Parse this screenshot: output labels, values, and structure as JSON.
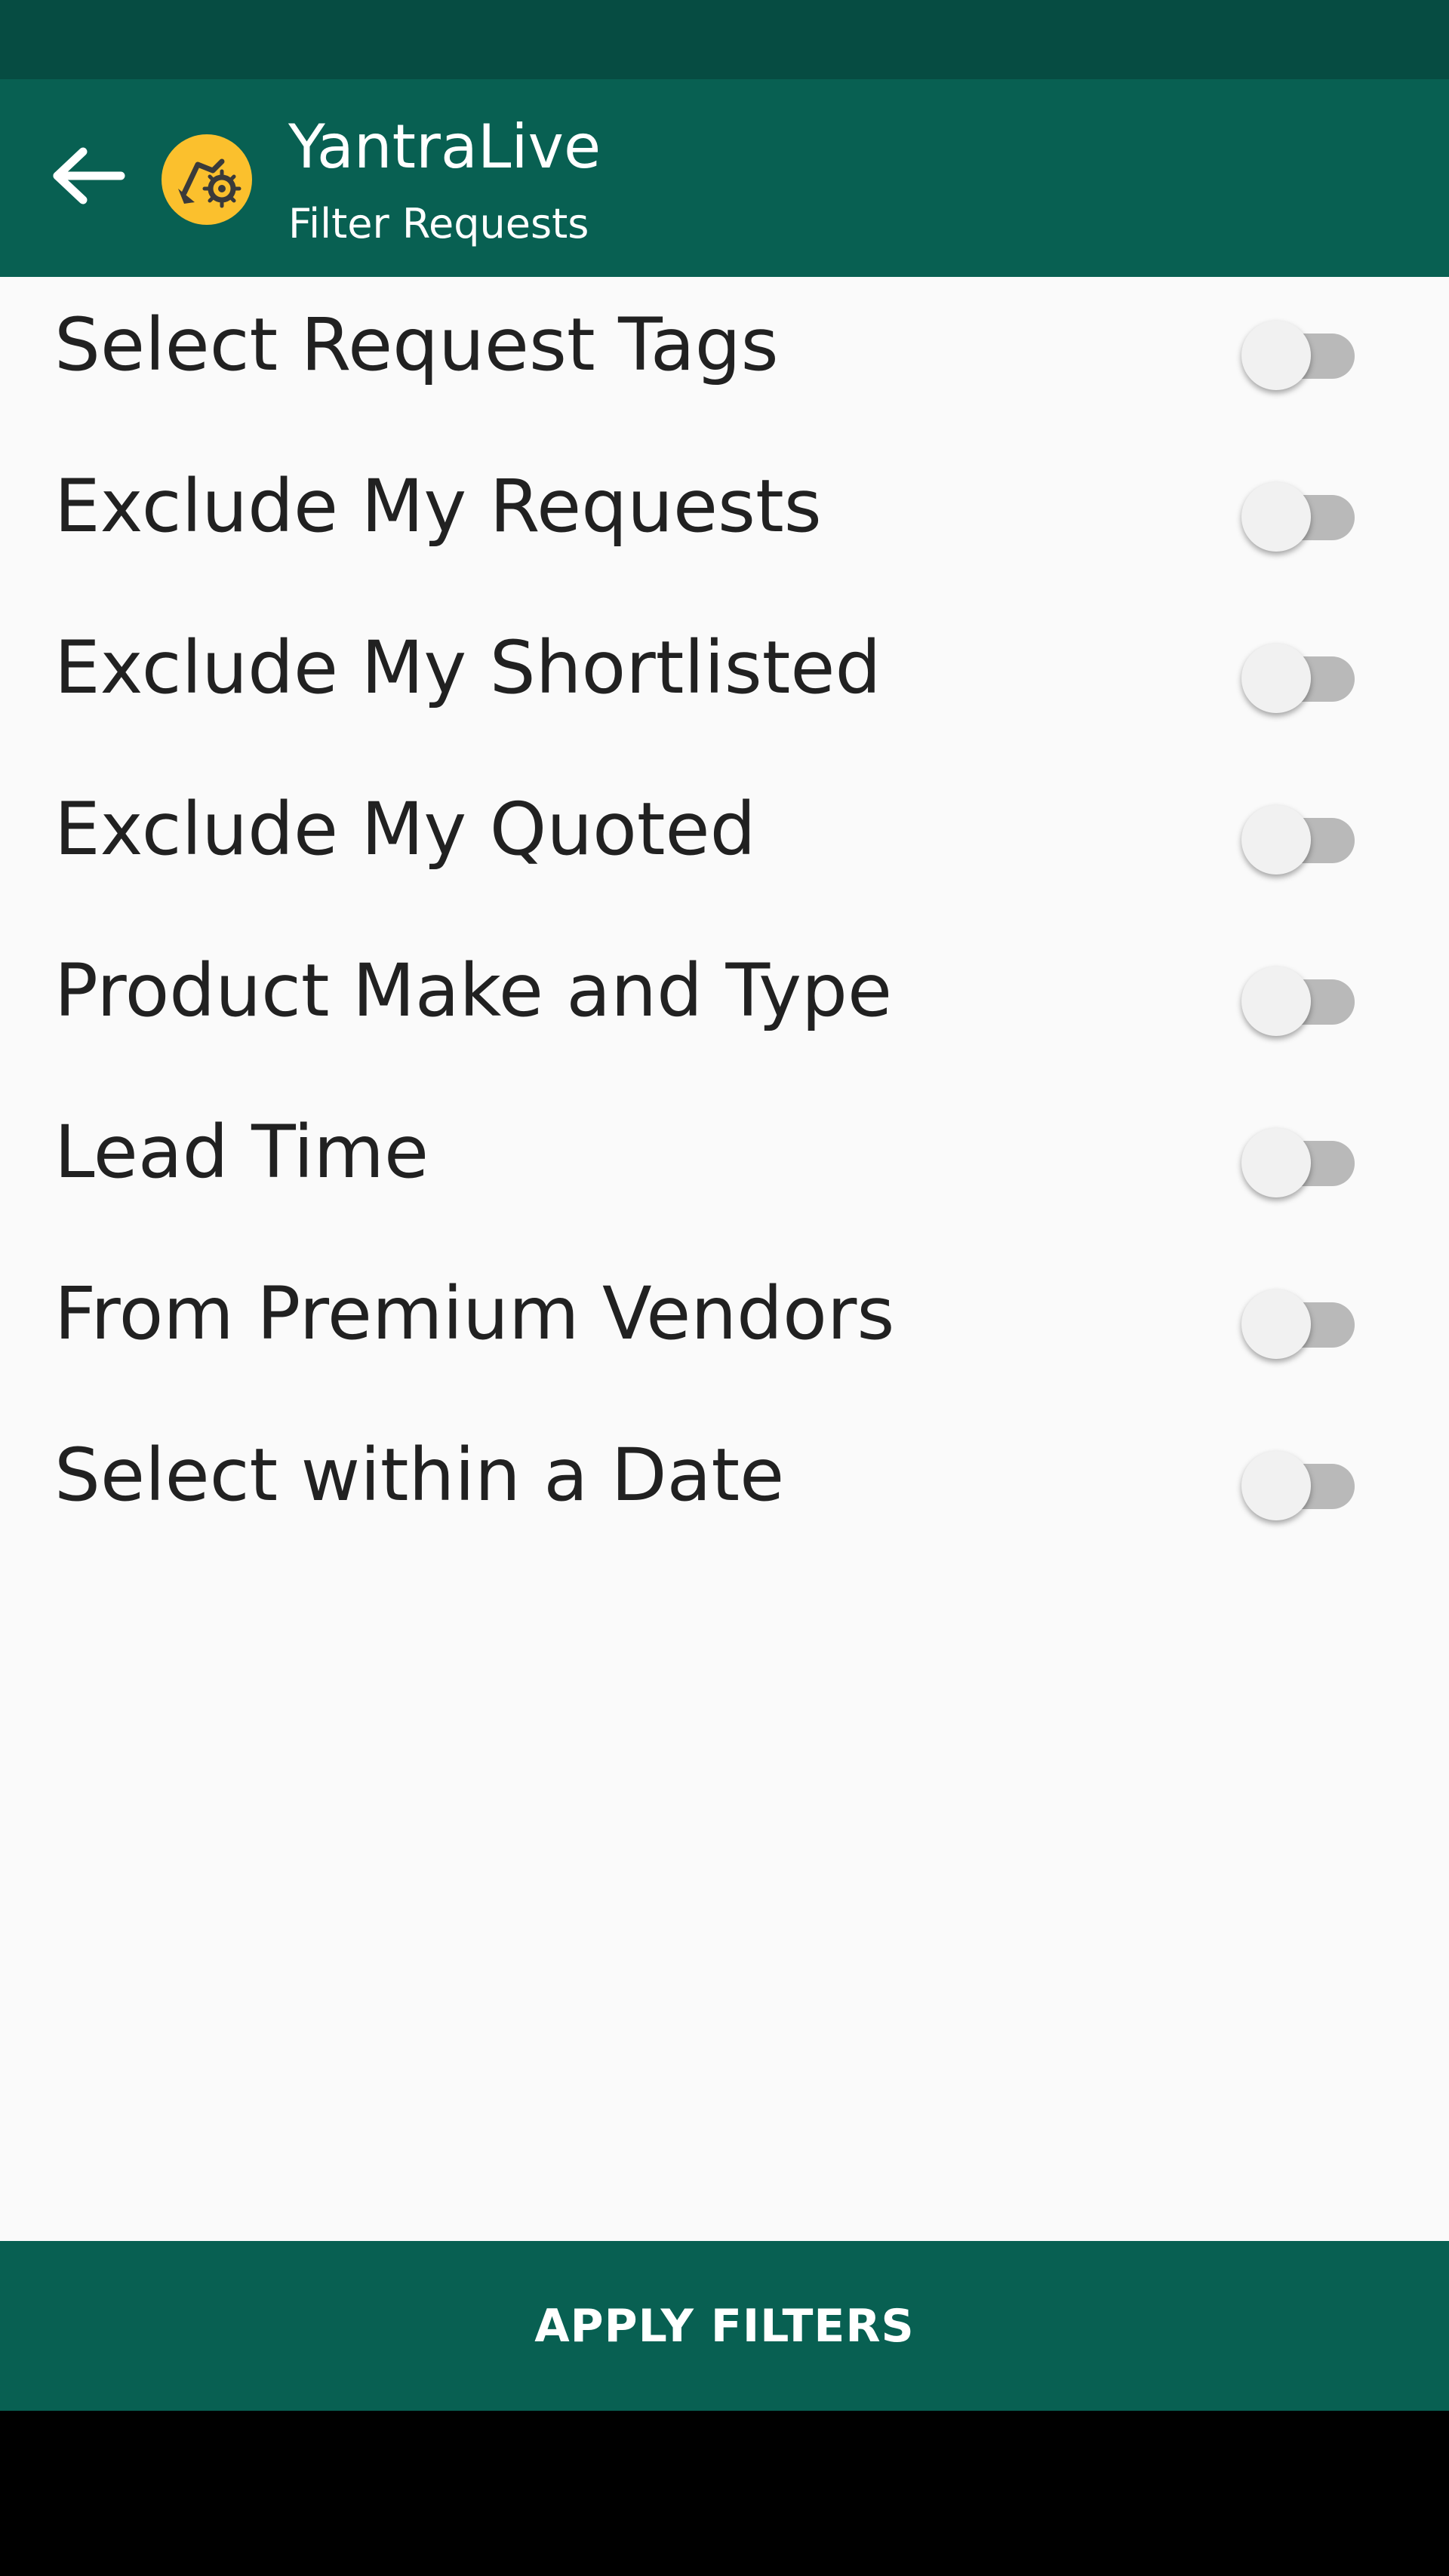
{
  "app_bar": {
    "title": "YantraLive",
    "subtitle": "Filter Requests",
    "back_icon": "arrow-left-icon",
    "logo_icon": "excavator-gear-logo"
  },
  "filters": [
    {
      "label": "Select Request Tags",
      "enabled": false
    },
    {
      "label": "Exclude My Requests",
      "enabled": false
    },
    {
      "label": "Exclude My Shortlisted",
      "enabled": false
    },
    {
      "label": "Exclude My Quoted",
      "enabled": false
    },
    {
      "label": "Product Make and Type",
      "enabled": false
    },
    {
      "label": "Lead Time",
      "enabled": false
    },
    {
      "label": "From Premium Vendors",
      "enabled": false
    },
    {
      "label": "Select within a Date",
      "enabled": false
    }
  ],
  "apply_button": {
    "label": "APPLY FILTERS"
  },
  "colors": {
    "status_bar": "#064c42",
    "app_bar": "#086052",
    "logo": "#fbc02d",
    "background": "#fafafa"
  }
}
